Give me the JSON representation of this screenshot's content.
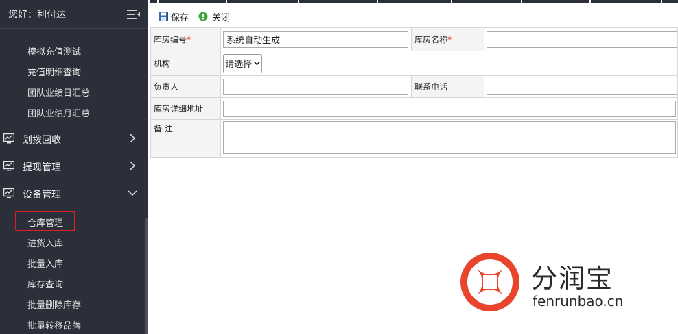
{
  "sidebar": {
    "greeting": "您好：利付达",
    "sub_items_top": [
      "模拟充值测试",
      "充值明细查询",
      "团队业绩日汇总",
      "团队业绩月汇总"
    ],
    "groups": [
      {
        "label": "划拨回收",
        "expanded": false
      },
      {
        "label": "提现管理",
        "expanded": false
      },
      {
        "label": "设备管理",
        "expanded": true
      }
    ],
    "device_items": [
      "仓库管理",
      "进货入库",
      "批量入库",
      "库存查询",
      "批量删除库存",
      "批量转移品牌"
    ],
    "active_item": "仓库管理"
  },
  "toolbar": {
    "save_label": "保存",
    "close_label": "关闭"
  },
  "form": {
    "code_label": "库房编号",
    "code_value": "系统自动生成",
    "name_label": "库房名称",
    "name_value": "",
    "org_label": "机构",
    "org_select": "请选择",
    "person_label": "负责人",
    "person_value": "",
    "phone_label": "联系电话",
    "phone_value": "",
    "address_label": "库房详细地址",
    "address_value": "",
    "remark_label": "备 注",
    "remark_value": "",
    "required_mark": "*"
  },
  "watermark": {
    "name": "分润宝",
    "url": "fenrunbao.cn",
    "color": "#e8452c"
  }
}
